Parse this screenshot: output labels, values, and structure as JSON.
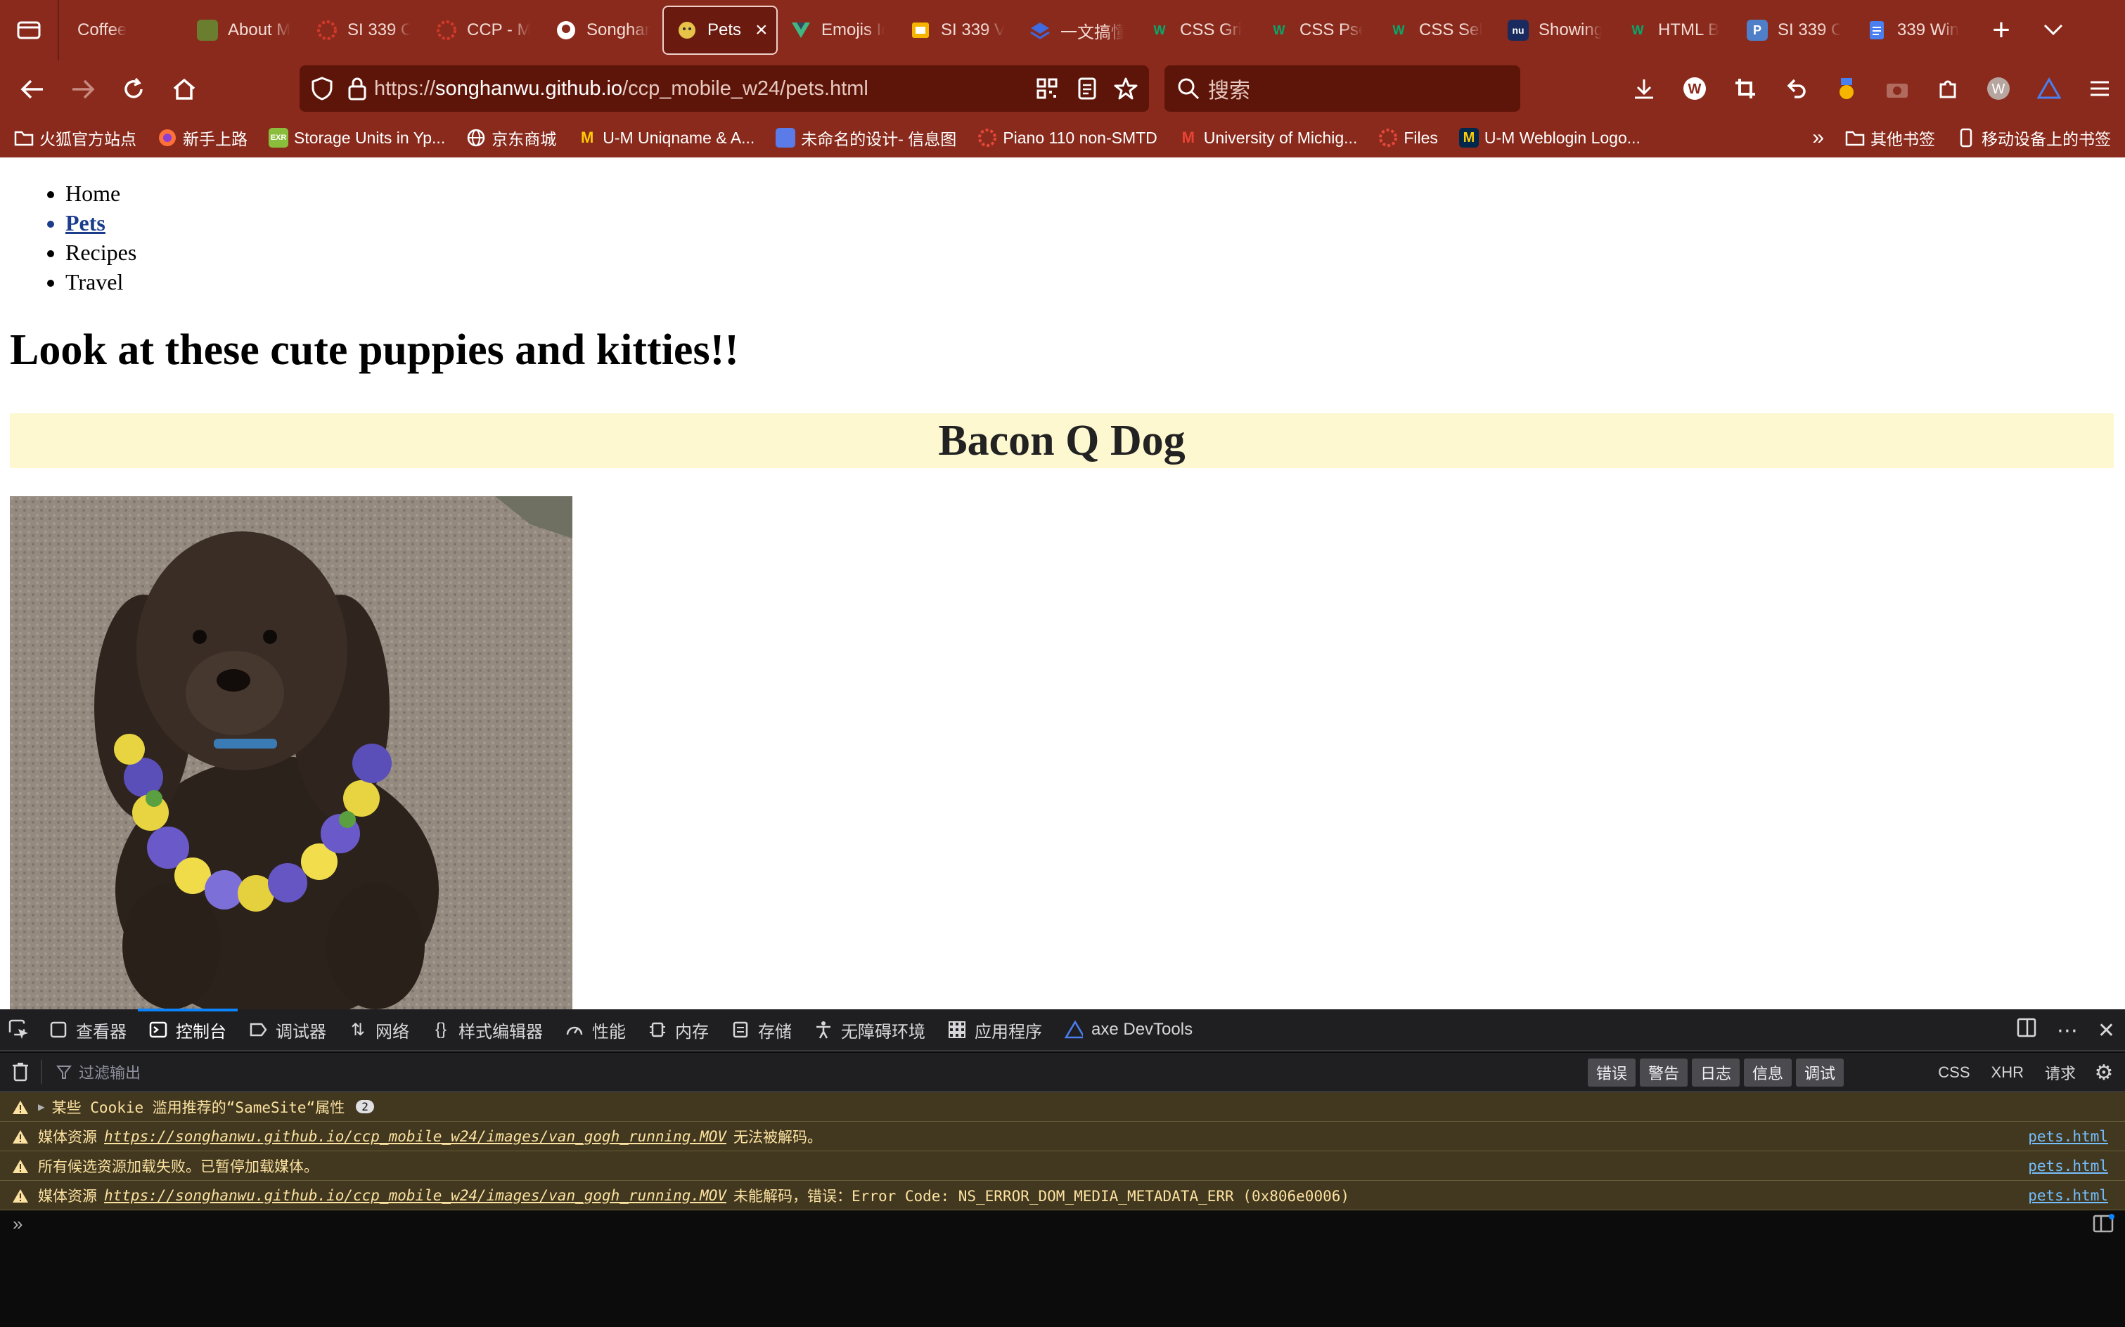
{
  "browser": {
    "tabs": [
      {
        "label": "Coffee",
        "icon": "none"
      },
      {
        "label": "About M",
        "icon": "photo-icon",
        "color": "#6b7d2f"
      },
      {
        "label": "SI 339 O",
        "icon": "canvas-icon",
        "color": "#d23a2b"
      },
      {
        "label": "CCP - M",
        "icon": "canvas-icon",
        "color": "#d23a2b"
      },
      {
        "label": "Songhar",
        "icon": "github-icon",
        "color": "#ffffff"
      },
      {
        "label": "Pets",
        "icon": "pet-icon",
        "color": "#e7c34a",
        "active": true
      },
      {
        "label": "Emojis Ic",
        "icon": "vue-icon",
        "color": "#41b883"
      },
      {
        "label": "SI 339 V",
        "icon": "slides-icon",
        "color": "#f4b400"
      },
      {
        "label": "一文搞懂",
        "icon": "stack-icon",
        "color": "#3f6ae0"
      },
      {
        "label": "CSS Gri",
        "icon": "w3-icon",
        "color": "#04aa6d"
      },
      {
        "label": "CSS Pse",
        "icon": "w3-icon",
        "color": "#04aa6d"
      },
      {
        "label": "CSS Sel",
        "icon": "w3-icon",
        "color": "#04aa6d"
      },
      {
        "label": "Showing",
        "icon": "nu-icon",
        "color": "#1a2a5e"
      },
      {
        "label": "HTML B",
        "icon": "w3-icon",
        "color": "#04aa6d"
      },
      {
        "label": "SI 339 C",
        "icon": "p-icon",
        "color": "#4f7fc9"
      },
      {
        "label": "339 Win",
        "icon": "docs-icon",
        "color": "#4a7ff0"
      }
    ],
    "url_domain": "songhanwu.github.io",
    "url_prefix": "https://",
    "url_path": "/ccp_mobile_w24/pets.html",
    "search_placeholder": "搜索",
    "bookmarks": [
      {
        "label": "火狐官方站点",
        "icon": "folder-icon"
      },
      {
        "label": "新手上路",
        "icon": "firefox-icon"
      },
      {
        "label": "Storage Units in Yp...",
        "icon": "exr-icon"
      },
      {
        "label": "京东商城",
        "icon": "globe-icon"
      },
      {
        "label": "U-M Uniqname & A...",
        "icon": "um-icon"
      },
      {
        "label": "未命名的设计- 信息图",
        "icon": "canva-icon"
      },
      {
        "label": "Piano 110 non-SMTD",
        "icon": "canvas-icon"
      },
      {
        "label": "University of Michig...",
        "icon": "gmail-icon"
      },
      {
        "label": "Files",
        "icon": "canvas-icon"
      },
      {
        "label": "U-M Weblogin Logo...",
        "icon": "um-icon"
      }
    ],
    "other_bookmarks": "其他书签",
    "mobile_bookmarks": "移动设备上的书签"
  },
  "page": {
    "nav": [
      "Home",
      "Pets",
      "Recipes",
      "Travel"
    ],
    "active_nav": "Pets",
    "heading": "Look at these cute puppies and kitties!!",
    "pet_name": "Bacon Q Dog",
    "band_color": "#fdf8cf"
  },
  "devtools": {
    "tabs": [
      "查看器",
      "控制台",
      "调试器",
      "网络",
      "样式编辑器",
      "性能",
      "内存",
      "存储",
      "无障碍环境",
      "应用程序",
      "axe DevTools"
    ],
    "active_tab": "控制台",
    "filter_placeholder": "过滤输出",
    "levels": [
      "错误",
      "警告",
      "日志",
      "信息",
      "调试"
    ],
    "types": [
      "CSS",
      "XHR",
      "请求"
    ],
    "messages": [
      {
        "prefix": "某些 Cookie 滥用推荐的“SameSite“属性",
        "count": "2",
        "link": "",
        "suffix": "",
        "source": ""
      },
      {
        "prefix": "媒体资源",
        "link": "https://songhanwu.github.io/ccp_mobile_w24/images/van_gogh_running.MOV",
        "suffix": "无法被解码。",
        "source": "pets.html"
      },
      {
        "prefix": "所有候选资源加载失败。已暂停加载媒体。",
        "link": "",
        "suffix": "",
        "source": "pets.html"
      },
      {
        "prefix": "媒体资源",
        "link": "https://songhanwu.github.io/ccp_mobile_w24/images/van_gogh_running.MOV",
        "suffix": "未能解码，错误：Error Code: NS_ERROR_DOM_MEDIA_METADATA_ERR (0x806e0006)",
        "source": "pets.html"
      }
    ],
    "prompt": "»"
  }
}
